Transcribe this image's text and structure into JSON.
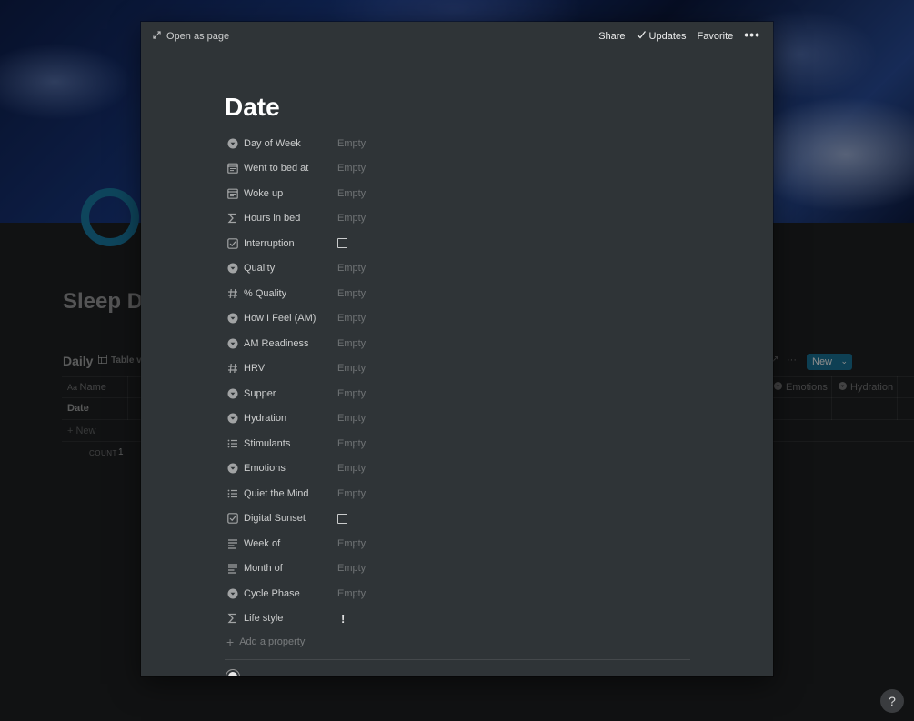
{
  "background": {
    "page_title": "Sleep D",
    "database_title": "Daily",
    "view_label": "Table v",
    "columns": {
      "name": "Name",
      "emotions": "Emotions",
      "hydration": "Hydration"
    },
    "rows": [
      {
        "name": "Date"
      }
    ],
    "new_row_label": "New",
    "count_label": "COUNT",
    "count_value": "1",
    "new_button_label": "New",
    "help_label": "?",
    "accent_color": "#1a7599"
  },
  "modal": {
    "open_as_page_label": "Open as page",
    "actions": {
      "share": "Share",
      "updates": "Updates",
      "favorite": "Favorite"
    },
    "title": "Date",
    "properties": [
      {
        "name": "Day of Week",
        "icon": "select-icon",
        "type": "text",
        "value": "Empty"
      },
      {
        "name": "Went to bed at",
        "icon": "calendar-icon",
        "type": "text",
        "value": "Empty"
      },
      {
        "name": "Woke up",
        "icon": "calendar-icon",
        "type": "text",
        "value": "Empty"
      },
      {
        "name": "Hours in bed",
        "icon": "formula-icon",
        "type": "text",
        "value": "Empty"
      },
      {
        "name": "Interruption",
        "icon": "checkbox-icon",
        "type": "checkbox",
        "value": ""
      },
      {
        "name": "Quality",
        "icon": "select-icon",
        "type": "text",
        "value": "Empty"
      },
      {
        "name": "% Quality",
        "icon": "number-icon",
        "type": "text",
        "value": "Empty"
      },
      {
        "name": "How I Feel (AM)",
        "icon": "select-icon",
        "type": "text",
        "value": "Empty"
      },
      {
        "name": "AM Readiness",
        "icon": "select-icon",
        "type": "text",
        "value": "Empty"
      },
      {
        "name": "HRV",
        "icon": "number-icon",
        "type": "text",
        "value": "Empty"
      },
      {
        "name": "Supper",
        "icon": "select-icon",
        "type": "text",
        "value": "Empty"
      },
      {
        "name": "Hydration",
        "icon": "select-icon",
        "type": "text",
        "value": "Empty"
      },
      {
        "name": "Stimulants",
        "icon": "list-icon",
        "type": "text",
        "value": "Empty"
      },
      {
        "name": "Emotions",
        "icon": "select-icon",
        "type": "text",
        "value": "Empty"
      },
      {
        "name": "Quiet the Mind",
        "icon": "list-icon",
        "type": "text",
        "value": "Empty"
      },
      {
        "name": "Digital Sunset",
        "icon": "checkbox-icon",
        "type": "checkbox",
        "value": ""
      },
      {
        "name": "Week of",
        "icon": "text-icon",
        "type": "text",
        "value": "Empty"
      },
      {
        "name": "Month of",
        "icon": "text-icon",
        "type": "text",
        "value": "Empty"
      },
      {
        "name": "Cycle Phase",
        "icon": "select-icon",
        "type": "text",
        "value": "Empty"
      },
      {
        "name": "Life style",
        "icon": "formula-icon",
        "type": "exclaim",
        "value": "!"
      }
    ],
    "add_property_label": "Add a property",
    "background_color": "#2f3437"
  }
}
